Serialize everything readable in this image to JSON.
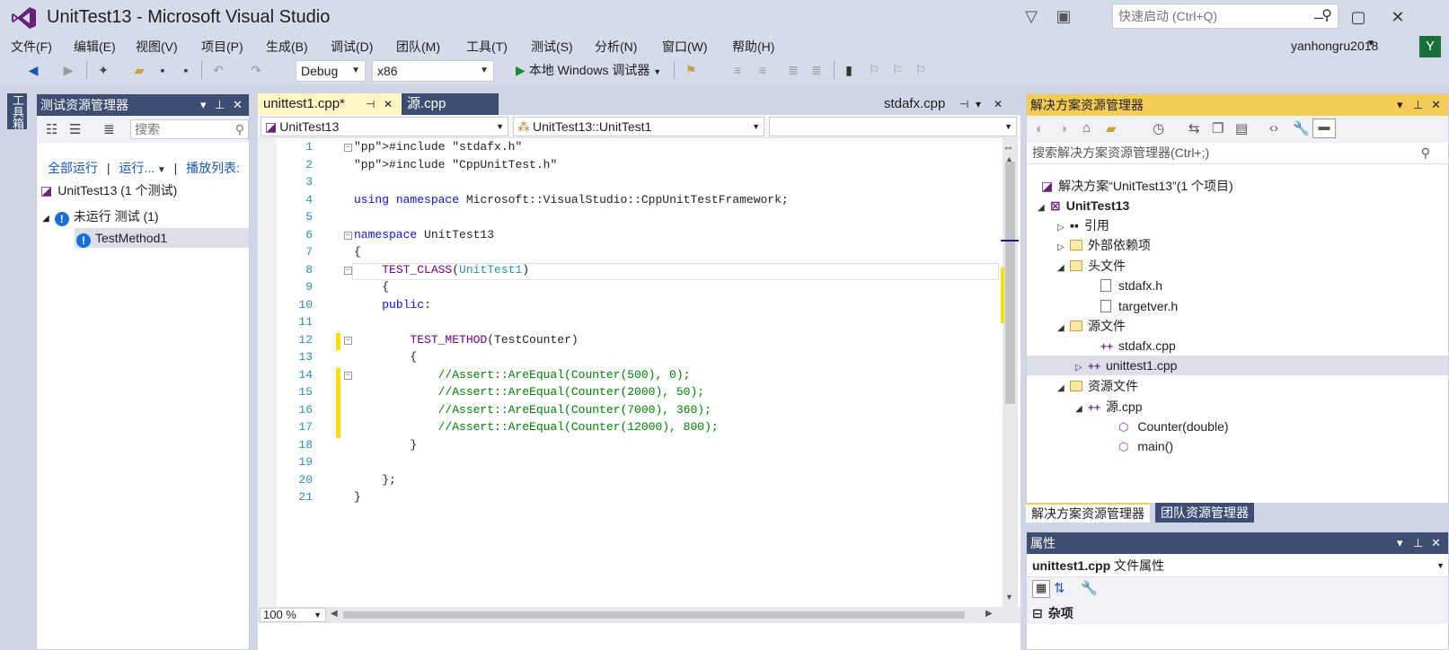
{
  "window": {
    "title": "UnitTest13 - Microsoft Visual Studio"
  },
  "quick_launch": {
    "placeholder": "快速启动 (Ctrl+Q)"
  },
  "menu": [
    "文件(F)",
    "编辑(E)",
    "视图(V)",
    "项目(P)",
    "生成(B)",
    "调试(D)",
    "团队(M)",
    "工具(T)",
    "测试(S)",
    "分析(N)",
    "窗口(W)",
    "帮助(H)"
  ],
  "user": {
    "name": "yanhongru2018",
    "avatar_letter": "Y",
    "avatar_color": "#1a6e3a"
  },
  "toolbar": {
    "config": "Debug",
    "platform": "x86",
    "run_label": "本地 Windows 调试器"
  },
  "toolbox_tab": "工具箱",
  "test_explorer": {
    "title": "测试资源管理器",
    "search_placeholder": "搜索",
    "links": {
      "run_all": "全部运行",
      "run": "运行...",
      "playlist": "播放列表:"
    },
    "project": "UnitTest13 (1 个测试)",
    "group": "未运行 测试 (1)",
    "method": "TestMethod1"
  },
  "editor": {
    "tabs": [
      {
        "label": "unittest1.cpp*"
      },
      {
        "label": "源.cpp"
      },
      {
        "label": "stdafx.cpp"
      }
    ],
    "nav": {
      "project": "UnitTest13",
      "scope": "UnitTest13::UnitTest1",
      "member": ""
    },
    "zoom": "100 %",
    "lines": [
      "#include \"stdafx.h\"",
      "#include \"CppUnitTest.h\"",
      "",
      "using namespace Microsoft::VisualStudio::CppUnitTestFramework;",
      "",
      "namespace UnitTest13",
      "{",
      "    TEST_CLASS(UnitTest1)",
      "    {",
      "    public:",
      "",
      "        TEST_METHOD(TestCounter)",
      "        {",
      "            //Assert::AreEqual(Counter(500), 0);",
      "            //Assert::AreEqual(Counter(2000), 50);",
      "            //Assert::AreEqual(Counter(7000), 360);",
      "            //Assert::AreEqual(Counter(12000), 800);",
      "        }",
      "",
      "    };",
      "}"
    ]
  },
  "solution_explorer": {
    "title": "解决方案资源管理器",
    "search_placeholder": "搜索解决方案资源管理器(Ctrl+;)",
    "solution": "解决方案“UnitTest13”(1 个项目)",
    "project": "UnitTest13",
    "references": "引用",
    "external_deps": "外部依赖项",
    "headers": "头文件",
    "header_files": [
      "stdafx.h",
      "targetver.h"
    ],
    "sources": "源文件",
    "source_files": [
      "stdafx.cpp",
      "unittest1.cpp"
    ],
    "resources": "资源文件",
    "resource_file": "源.cpp",
    "functions": [
      "Counter(double)",
      "main()"
    ],
    "bottom_tabs": [
      "解决方案资源管理器",
      "团队资源管理器"
    ]
  },
  "properties": {
    "title": "属性",
    "object": "unittest1.cpp",
    "object_kind": "文件属性",
    "category": "杂项"
  }
}
